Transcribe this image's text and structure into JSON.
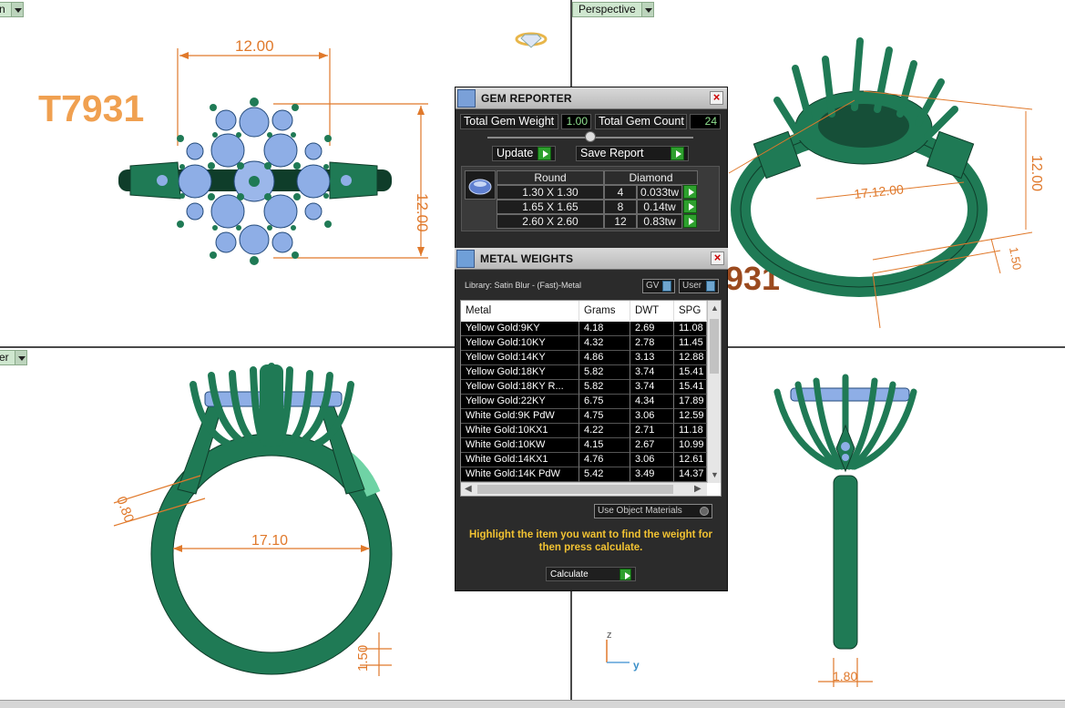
{
  "viewports": {
    "top_left": {
      "label": "n"
    },
    "top_right": {
      "label": "Perspective"
    },
    "bottom_left": {
      "label": "er"
    }
  },
  "model_code": "T7931",
  "dimensions": {
    "top_width": "12.00",
    "top_height": "12.00",
    "persp_height": "12.00",
    "persp_overlap": "17.12.00",
    "persp_small": "1.50",
    "persp_ghost_text": "931",
    "front_inner": "17.10",
    "front_left": "0.80",
    "front_bottom": "1.50",
    "side_bottom": "1.80"
  },
  "axis": {
    "z": "z",
    "y": "y"
  },
  "gem_reporter": {
    "title": "GEM REPORTER",
    "total_gem_weight_label": "Total Gem Weight",
    "total_gem_weight": "1.00",
    "total_gem_count_label": "Total Gem Count",
    "total_gem_count": "24",
    "update_label": "Update",
    "save_report_label": "Save Report",
    "table_headers": [
      "Round",
      "Diamond"
    ],
    "gems": [
      {
        "size": "1.30 X 1.30",
        "count": "4",
        "weight": "0.033tw"
      },
      {
        "size": "1.65 X 1.65",
        "count": "8",
        "weight": "0.14tw"
      },
      {
        "size": "2.60 X 2.60",
        "count": "12",
        "weight": "0.83tw"
      }
    ]
  },
  "metal_weights": {
    "title": "METAL WEIGHTS",
    "library": "Library: Satin Blur - (Fast)-Metal",
    "gv_label": "GV",
    "user_label": "User",
    "columns": [
      "Metal",
      "Grams",
      "DWT",
      "SPG"
    ],
    "rows": [
      [
        "Yellow Gold:9KY",
        "4.18",
        "2.69",
        "11.08"
      ],
      [
        "Yellow Gold:10KY",
        "4.32",
        "2.78",
        "11.45"
      ],
      [
        "Yellow Gold:14KY",
        "4.86",
        "3.13",
        "12.88"
      ],
      [
        "Yellow Gold:18KY",
        "5.82",
        "3.74",
        "15.41"
      ],
      [
        "Yellow Gold:18KY R...",
        "5.82",
        "3.74",
        "15.41"
      ],
      [
        "Yellow Gold:22KY",
        "6.75",
        "4.34",
        "17.89"
      ],
      [
        "White Gold:9K PdW",
        "4.75",
        "3.06",
        "12.59"
      ],
      [
        "White Gold:10KX1",
        "4.22",
        "2.71",
        "11.18"
      ],
      [
        "White Gold:10KW",
        "4.15",
        "2.67",
        "10.99"
      ],
      [
        "White Gold:14KX1",
        "4.76",
        "3.06",
        "12.61"
      ],
      [
        "White Gold:14K PdW",
        "5.42",
        "3.49",
        "14.37"
      ]
    ],
    "use_object_materials": "Use Object Materials",
    "hint": "Highlight the item you want to find the weight for then press calculate.",
    "calculate_label": "Calculate"
  },
  "colors": {
    "ring": "#1f7a55",
    "ring_light": "#3ea97a",
    "gem": "#8eaee6",
    "dimension": "#e0792b",
    "panel_bg": "#2b2b2b",
    "accent_green": "#2ea02e",
    "hint": "#f1c232"
  }
}
